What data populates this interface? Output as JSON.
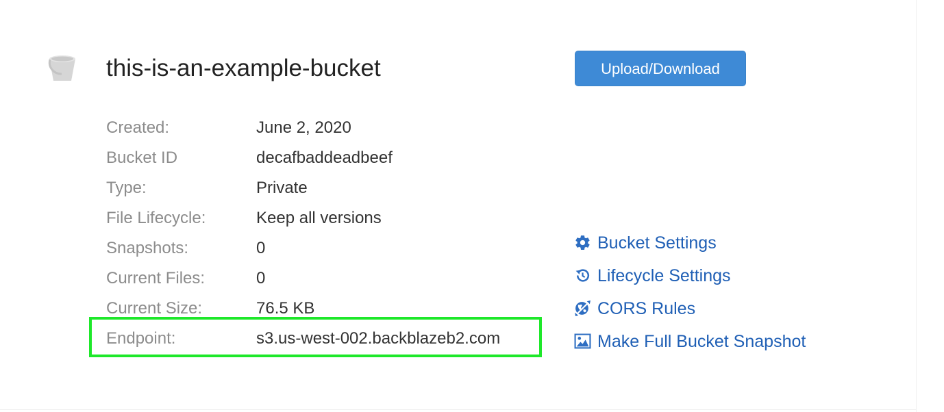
{
  "bucket": {
    "name": "this-is-an-example-bucket",
    "icon": "bucket-icon"
  },
  "upload_button": {
    "label": "Upload/Download"
  },
  "details": [
    {
      "label": "Created:",
      "value": "June 2, 2020"
    },
    {
      "label": "Bucket ID",
      "value": "decafbaddeadbeef"
    },
    {
      "label": "Type:",
      "value": "Private"
    },
    {
      "label": "File Lifecycle:",
      "value": "Keep all versions"
    },
    {
      "label": "Snapshots:",
      "value": "0"
    },
    {
      "label": "Current Files:",
      "value": "0"
    },
    {
      "label": "Current Size:",
      "value": "76.5 KB"
    },
    {
      "label": "Endpoint:",
      "value": "s3.us-west-002.backblazeb2.com"
    }
  ],
  "actions": [
    {
      "label": "Bucket Settings",
      "icon": "gear-icon"
    },
    {
      "label": "Lifecycle Settings",
      "icon": "history-clock-icon"
    },
    {
      "label": "CORS Rules",
      "icon": "globe-arrows-icon"
    },
    {
      "label": "Make Full Bucket Snapshot",
      "icon": "image-icon"
    }
  ],
  "colors": {
    "accent_button": "#3e8ad6",
    "link": "#1f5fb5",
    "label": "#8c8c8c",
    "value": "#333333",
    "highlight": "#1ee82a"
  }
}
